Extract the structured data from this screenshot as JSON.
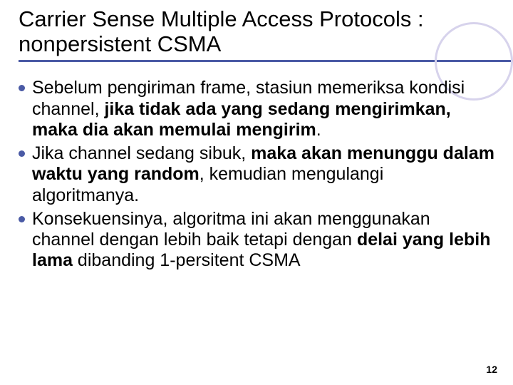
{
  "title": "Carrier Sense Multiple Access Protocols : nonpersistent CSMA",
  "bullets": {
    "b1_pre": "Sebelum pengiriman frame, stasiun memeriksa kondisi channel, ",
    "b1_bold": "jika tidak ada yang sedang mengirimkan, maka dia akan memulai mengirim",
    "b1_post": ".",
    "b2_pre": "Jika channel sedang sibuk, ",
    "b2_bold": "maka akan menunggu dalam waktu yang random",
    "b2_post": ", kemudian mengulangi algoritmanya.",
    "b3_pre": "Konsekuensinya, algoritma ini akan menggunakan channel dengan lebih baik tetapi dengan ",
    "b3_bold": "delai yang lebih lama",
    "b3_post": " dibanding 1-persitent CSMA"
  },
  "page_number": "12"
}
